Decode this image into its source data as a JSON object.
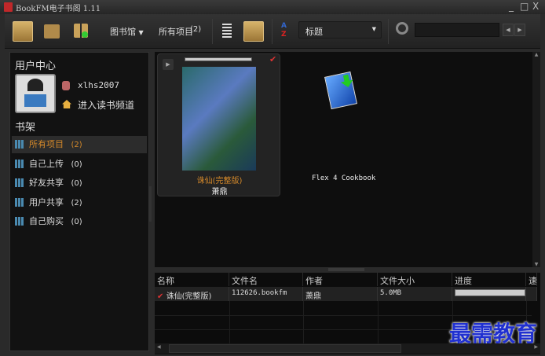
{
  "window": {
    "title": "BookFM电子书阁 1.11",
    "minimize": "_",
    "maximize": "□",
    "close": "X"
  },
  "toolbar": {
    "library_label": "图书馆",
    "filter_label": "所有项目",
    "filter_count": "(2)",
    "sort_field": "标题",
    "search_value": ""
  },
  "sidebar": {
    "user_center": "用户中心",
    "username": "xlhs2007",
    "channel_link": "进入读书频道",
    "shelf_title": "书架",
    "items": [
      {
        "label": "所有项目",
        "count": "(2)"
      },
      {
        "label": "自己上传",
        "count": "(0)"
      },
      {
        "label": "好友共享",
        "count": "(0)"
      },
      {
        "label": "用户共享",
        "count": "(2)"
      },
      {
        "label": "自己购买",
        "count": "(0)"
      }
    ]
  },
  "books": [
    {
      "title": "诛仙(完整版)",
      "author": "萧鼎",
      "progress": 100
    },
    {
      "title": "Flex 4 Cookbook"
    }
  ],
  "table": {
    "columns": [
      "名称",
      "文件名",
      "作者",
      "文件大小",
      "进度",
      "速度"
    ],
    "rows": [
      {
        "name": "诛仙(完整版)",
        "file": "112626.bookfm",
        "author": "萧鼎",
        "size": "5.0MB",
        "progress": 100
      }
    ]
  },
  "watermark": "最需教育",
  "colors": {
    "accent": "#d68a2a",
    "selected": "#c9a25a"
  }
}
